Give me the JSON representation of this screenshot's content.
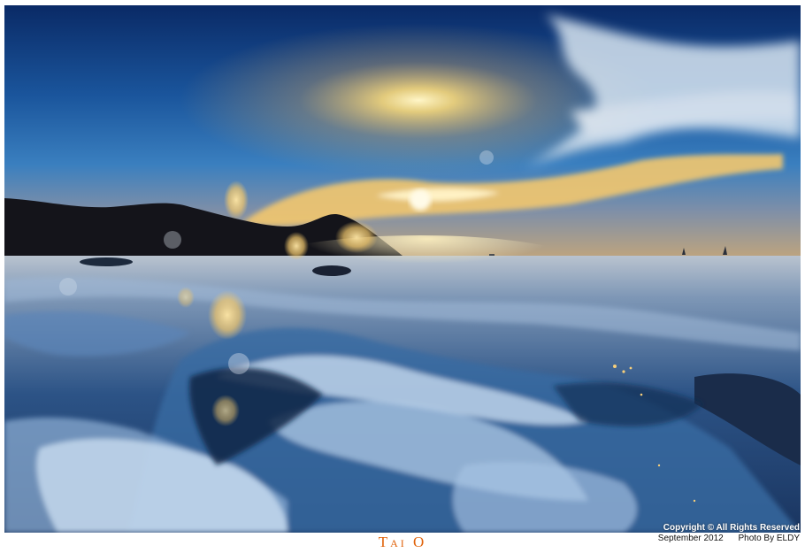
{
  "caption": {
    "title": "Tai O"
  },
  "credit": {
    "copyright": "Copyright © All Rights Reserved",
    "date": "September 2012",
    "photographer": "Photo By ELDY"
  },
  "colors": {
    "sky_top": "#0b2f6e",
    "sky_mid": "#1e62a8",
    "horizon_glow": "#f6d27a",
    "sea_dark": "#1b3d6e",
    "foam": "#c9ddf0",
    "title_orange": "#e0620a"
  }
}
